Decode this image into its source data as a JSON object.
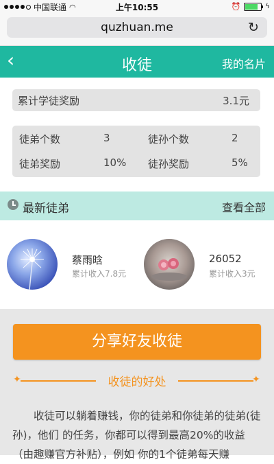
{
  "status": {
    "carrier": "中国联通",
    "time": "上午10:55",
    "signal_bars_filled": 4,
    "battery_level": 0.92
  },
  "browser": {
    "url": "quzhuan.me",
    "reload_icon": "reload-icon"
  },
  "header": {
    "back_icon": "chevron-left-icon",
    "title": "收徒",
    "right_link": "我的名片"
  },
  "total": {
    "label": "累计学徒奖励",
    "value": "3.1元"
  },
  "stats": {
    "apprentice_count_label": "徒弟个数",
    "apprentice_count": "3",
    "grand_count_label": "徒孙个数",
    "grand_count": "2",
    "apprentice_reward_label": "徒弟奖励",
    "apprentice_reward": "10%",
    "grand_reward_label": "徒孙奖励",
    "grand_reward": "5%"
  },
  "latest": {
    "icon": "clock-icon",
    "title": "最新徒弟",
    "view_all": "查看全部"
  },
  "users": [
    {
      "name": "蔡雨晗",
      "income": "累计收入7.8元"
    },
    {
      "name": "26052",
      "income": "累计收入3元"
    }
  ],
  "share_button": "分享好友收徒",
  "benefit_title": "收徒的好处",
  "description": "收徒可以躺着赚钱，你的徒弟和你徒弟的徒弟(徒孙)，他们 的任务，你都可以得到最高20%的收益（由趣赚官方补贴），例如 你的1个徒弟每天赚",
  "colors": {
    "header": "#1fb8a0",
    "latest_bar": "#bdeae2",
    "accent": "#f4931f"
  }
}
